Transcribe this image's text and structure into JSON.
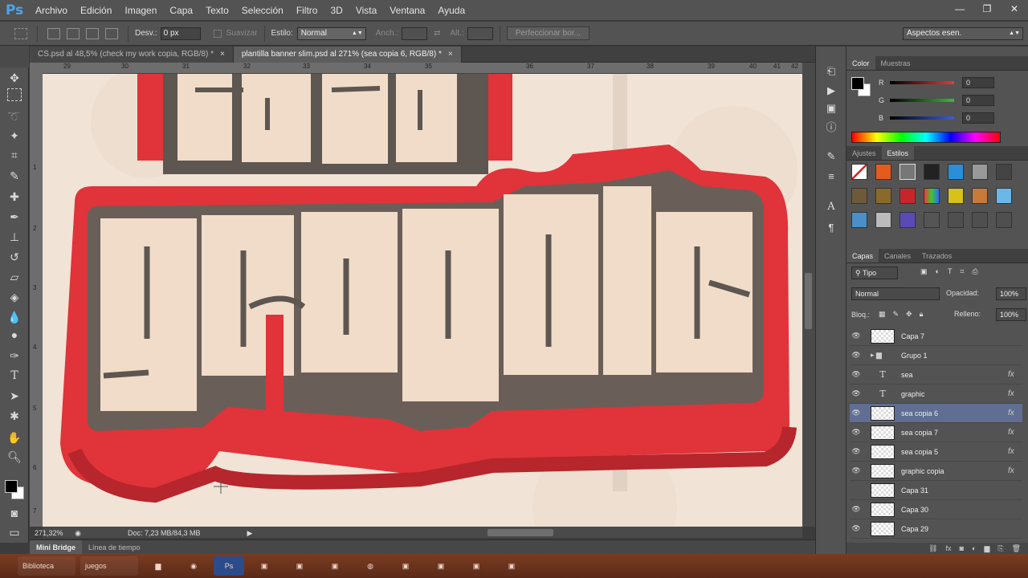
{
  "app": {
    "logo": "Ps"
  },
  "menu": [
    "Archivo",
    "Edición",
    "Imagen",
    "Capa",
    "Texto",
    "Selección",
    "Filtro",
    "3D",
    "Vista",
    "Ventana",
    "Ayuda"
  ],
  "window_controls": {
    "minimize": "—",
    "restore": "❐",
    "close": "✕"
  },
  "options": {
    "feather_label": "Desv.:",
    "feather_value": "0 px",
    "antialias_label": "Suavizar",
    "style_label": "Estilo:",
    "style_value": "Normal",
    "width_label": "Anch.:",
    "height_label": "Alt.:",
    "refine_button": "Perfeccionar bor...",
    "workspace": "Aspectos esen."
  },
  "tabs": [
    {
      "label": "CS.psd al 48,5% (check my work copia, RGB/8) *",
      "close": "×"
    },
    {
      "label": "plantilla banner slim.psd al 271% (sea copia 6, RGB/8) *",
      "close": "×"
    }
  ],
  "ruler": {
    "top": [
      "29",
      "30",
      "31",
      "32",
      "33",
      "34",
      "35",
      "36",
      "37",
      "38",
      "39",
      "40",
      "41",
      "42"
    ],
    "left": [
      "1",
      "2",
      "3",
      "4",
      "5",
      "6",
      "7"
    ]
  },
  "canvas_text": {
    "main": "graphic",
    "top": "sea"
  },
  "status": {
    "zoom": "271,32%",
    "doc": "Doc: 7,23 MB/84,3 MB"
  },
  "bottom_tabs": [
    "Mini Bridge",
    "Línea de tiempo"
  ],
  "color_panel": {
    "tabs": [
      "Color",
      "Muestras"
    ],
    "channels": [
      {
        "label": "R",
        "value": "0"
      },
      {
        "label": "G",
        "value": "0"
      },
      {
        "label": "B",
        "value": "0"
      }
    ],
    "colors": {
      "r": "#e23b3b",
      "g": "#3bb83b",
      "b": "#3b5be2",
      "fg": "#000000",
      "bg": "#ffffff"
    }
  },
  "styles_panel": {
    "tabs": [
      "Ajustes",
      "Estilos"
    ]
  },
  "layers_panel": {
    "tabs": [
      "Capas",
      "Canales",
      "Trazados"
    ],
    "filter": "Tipo",
    "blend": "Normal",
    "opacity_label": "Opacidad:",
    "opacity": "100%",
    "lock_label": "Bloq.:",
    "fill_label": "Relleno:",
    "fill": "100%",
    "layers": [
      {
        "name": "Capa 7",
        "kind": "pixel",
        "visible": true,
        "fx": false,
        "selected": false
      },
      {
        "name": "Grupo 1",
        "kind": "group",
        "visible": true,
        "fx": false,
        "selected": false
      },
      {
        "name": "sea",
        "kind": "text",
        "visible": true,
        "fx": true,
        "selected": false
      },
      {
        "name": "graphic",
        "kind": "text",
        "visible": true,
        "fx": true,
        "selected": false
      },
      {
        "name": "sea copia 6",
        "kind": "pixel",
        "visible": true,
        "fx": true,
        "selected": true
      },
      {
        "name": "sea copia 7",
        "kind": "pixel",
        "visible": true,
        "fx": true,
        "selected": false
      },
      {
        "name": "sea copia 5",
        "kind": "pixel",
        "visible": true,
        "fx": true,
        "selected": false
      },
      {
        "name": "graphic copia",
        "kind": "pixel",
        "visible": true,
        "fx": true,
        "selected": false
      },
      {
        "name": "Capa 31",
        "kind": "pixel",
        "visible": false,
        "fx": false,
        "selected": false
      },
      {
        "name": "Capa 30",
        "kind": "pixel",
        "visible": true,
        "fx": false,
        "selected": false
      },
      {
        "name": "Capa 29",
        "kind": "pixel",
        "visible": true,
        "fx": false,
        "selected": false
      }
    ]
  },
  "taskbar": [
    "Biblioteca",
    "juegos"
  ]
}
